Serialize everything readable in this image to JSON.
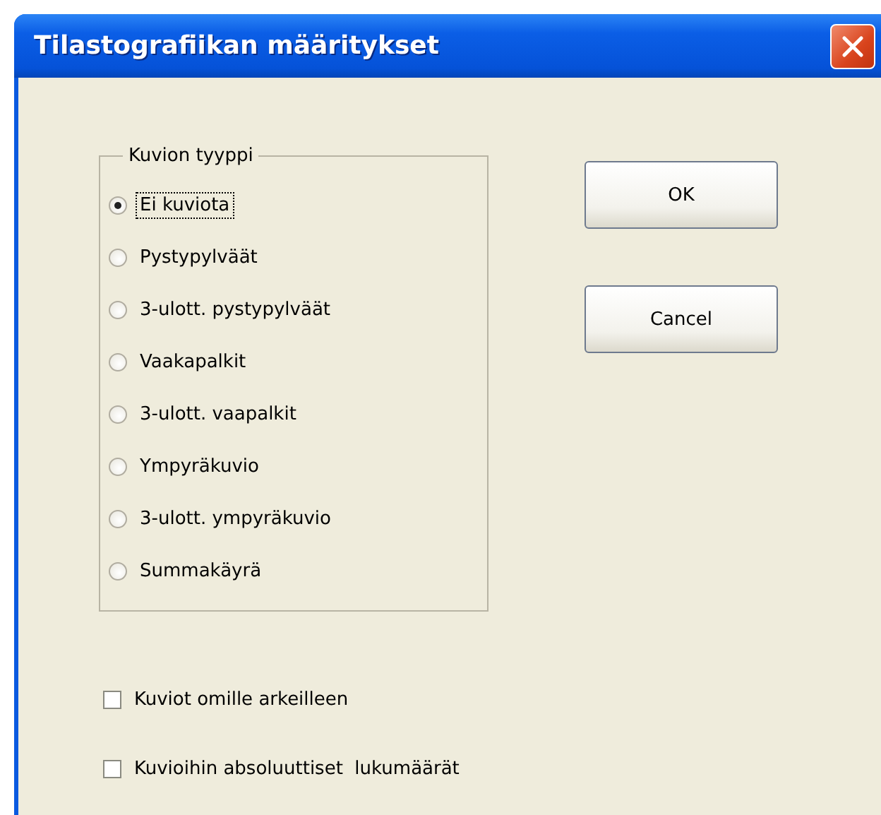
{
  "window": {
    "title": "Tilastografiikan määritykset"
  },
  "group": {
    "title": "Kuvion tyyppi",
    "options": [
      {
        "label": "Ei kuviota",
        "selected": true
      },
      {
        "label": "Pystypylväät",
        "selected": false
      },
      {
        "label": "3-ulott. pystypylväät",
        "selected": false
      },
      {
        "label": "Vaakapalkit",
        "selected": false
      },
      {
        "label": "3-ulott. vaapalkit",
        "selected": false
      },
      {
        "label": "Ympyräkuvio",
        "selected": false
      },
      {
        "label": "3-ulott. ympyräkuvio",
        "selected": false
      },
      {
        "label": "Summakäyrä",
        "selected": false
      }
    ]
  },
  "buttons": [
    "OK",
    "Cancel"
  ],
  "checkboxes": [
    {
      "label": "Kuviot omille arkeilleen",
      "checked": false
    },
    {
      "label": "Kuvioihin absoluuttiset  lukumäärät",
      "checked": false
    }
  ]
}
